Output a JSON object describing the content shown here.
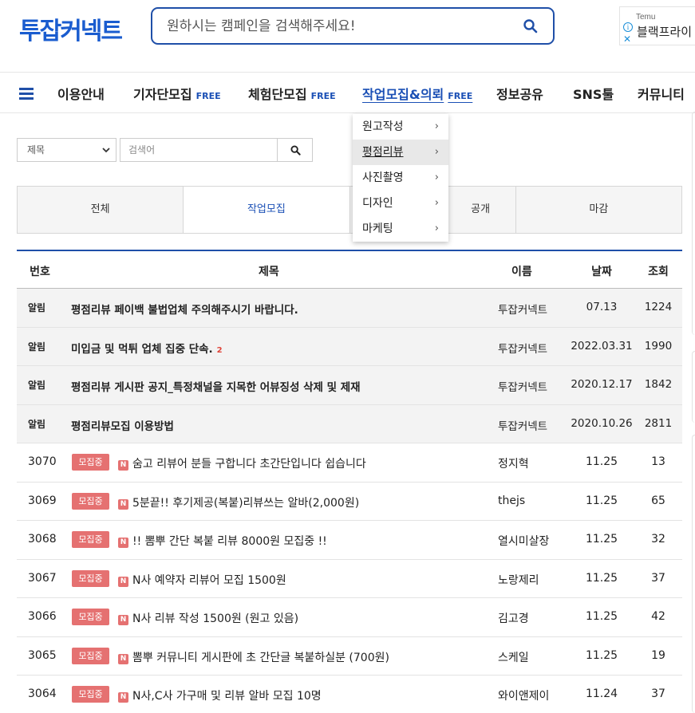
{
  "header": {
    "logo": "투잡커넥트",
    "search_placeholder": "원하시는 캠페인을 검색해주세요!"
  },
  "ad": {
    "brand": "Temu",
    "text": "블랙프라이",
    "info": "i",
    "close": "✕"
  },
  "nav": {
    "items": [
      {
        "label": "이용안내",
        "free": ""
      },
      {
        "label": "기자단모집",
        "free": "FREE"
      },
      {
        "label": "체험단모집",
        "free": "FREE"
      },
      {
        "label": "작업모집&의뢰",
        "free": "FREE"
      },
      {
        "label": "정보공유",
        "free": ""
      },
      {
        "label": "SNS툴",
        "free": ""
      },
      {
        "label": "커뮤니티",
        "free": ""
      }
    ]
  },
  "dropdown": {
    "items": [
      "원고작성",
      "평점리뷰",
      "사진촬영",
      "디자인",
      "마케팅"
    ],
    "chevron": "›"
  },
  "filter": {
    "select_value": "제목",
    "keyword_placeholder": "검색어"
  },
  "tabs": [
    "전체",
    "작업모집",
    "공개",
    "마감"
  ],
  "table": {
    "headers": {
      "no": "번호",
      "title": "제목",
      "name": "이름",
      "date": "날짜",
      "views": "조회"
    },
    "notices": [
      {
        "no": "알림",
        "title": "평점리뷰 페이백 불법업체 주의해주시기 바랍니다.",
        "count": "",
        "name": "투잡커넥트",
        "date": "07.13",
        "views": "1224"
      },
      {
        "no": "알림",
        "title": "미입금 및 먹튀 업체 집중 단속.",
        "count": "2",
        "name": "투잡커넥트",
        "date": "2022.03.31",
        "views": "1990"
      },
      {
        "no": "알림",
        "title": "평점리뷰 게시판 공지_특정채널을 지목한 어뷰징성 삭제 및 제재",
        "count": "",
        "name": "투잡커넥트",
        "date": "2020.12.17",
        "views": "1842"
      },
      {
        "no": "알림",
        "title": "평점리뷰모집 이용방법",
        "count": "",
        "name": "투잡커넥트",
        "date": "2020.10.26",
        "views": "2811"
      }
    ],
    "badge": "모집중",
    "new_mark": "N",
    "posts": [
      {
        "no": "3070",
        "title": "숨고 리뷰어 분들 구합니다 초간단입니다 쉽습니다",
        "name": "정지혁",
        "date": "11.25",
        "views": "13"
      },
      {
        "no": "3069",
        "title": "5분끝!! 후기제공(복붙)리뷰쓰는 알바(2,000원)",
        "name": "thejs",
        "date": "11.25",
        "views": "65"
      },
      {
        "no": "3068",
        "title": "!! 뽐뿌 간단 복붙 리뷰 8000원 모집중 !!",
        "name": "열시미살장",
        "date": "11.25",
        "views": "32"
      },
      {
        "no": "3067",
        "title": "N사 예약자 리뷰어 모집 1500원",
        "name": "노랑제리",
        "date": "11.25",
        "views": "37"
      },
      {
        "no": "3066",
        "title": "N사 리뷰 작성 1500원 (원고 있음)",
        "name": "김고경",
        "date": "11.25",
        "views": "42"
      },
      {
        "no": "3065",
        "title": "뽐뿌 커뮤니티 게시판에 초 간단글 복붙하실분 (700원)",
        "name": "스케일",
        "date": "11.25",
        "views": "19"
      },
      {
        "no": "3064",
        "title": "N사,C사 가구매 및 리뷰 알바 모집 10명",
        "name": "와이앤제이",
        "date": "11.24",
        "views": "37"
      }
    ]
  }
}
